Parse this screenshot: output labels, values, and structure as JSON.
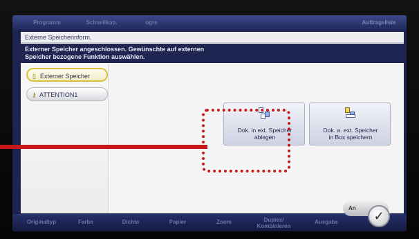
{
  "top_tabs": {
    "program": "Programm",
    "quick_copy": "Schnellkop.",
    "third": "ogre",
    "job_list": "Auftragsliste"
  },
  "dialog": {
    "title": "Externe Speicherinform.",
    "message_line1": "Externer Speicher angeschlossen. Gewünschte auf externen",
    "message_line2": "Speicher bezogene Funktion auswählen."
  },
  "side_panel": {
    "items": [
      {
        "label": "Externer Speicher",
        "icon": "usb-drive-icon",
        "active": true
      },
      {
        "label": "ATTENTION1",
        "icon": "key-icon",
        "active": false
      }
    ]
  },
  "functions": [
    {
      "label_line1": "Dok. in ext. Speicher",
      "label_line2": "ablegen",
      "icon": "save-to-external-icon"
    },
    {
      "label_line1": "Dok. a. ext. Speicher",
      "label_line2": "in Box speichern",
      "icon": "save-to-box-icon"
    }
  ],
  "bottom_tabs": {
    "original_type": "Originaltyp",
    "color": "Farbe",
    "density": "Dichte",
    "paper": "Papier",
    "zoom": "Zoom",
    "duplex_line1": "Duplex/",
    "duplex_line2": "Kombinieren",
    "output": "Ausgabe",
    "ok_label": "An"
  },
  "colors": {
    "highlight": "#c71a1a",
    "screen_bg": "#1e2450",
    "active_border": "#d8c23c"
  }
}
